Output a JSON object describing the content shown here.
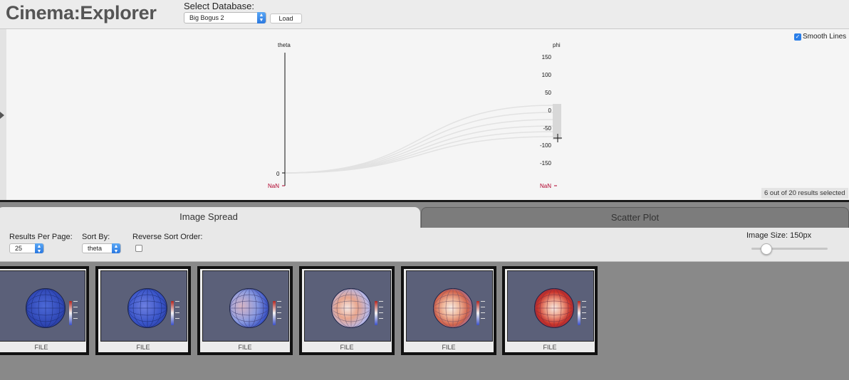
{
  "header": {
    "title": "Cinema:Explorer",
    "db_label": "Select Database:",
    "db_selected": "Big Bogus 2",
    "load_label": "Load"
  },
  "plot": {
    "axes": [
      {
        "name": "theta",
        "ticks": [
          "0"
        ],
        "nan_label": "NaN"
      },
      {
        "name": "phi",
        "ticks": [
          "150",
          "100",
          "50",
          "0",
          "-50",
          "-100",
          "-150"
        ],
        "nan_label": "NaN"
      }
    ],
    "smooth_lines_label": "Smooth Lines",
    "smooth_lines_checked": true,
    "selected_count": "6 out of 20 results selected"
  },
  "tabs": [
    {
      "label": "Image Spread",
      "active": true
    },
    {
      "label": "Scatter Plot",
      "active": false
    }
  ],
  "controls": {
    "results_per_page_label": "Results Per Page:",
    "results_per_page_value": "25",
    "sort_by_label": "Sort By:",
    "sort_by_value": "theta",
    "reverse_sort_label": "Reverse Sort Order:",
    "reverse_sort_checked": false,
    "image_size_label": "Image Size: 150px"
  },
  "results": [
    {
      "label": "FILE"
    },
    {
      "label": "FILE"
    },
    {
      "label": "FILE"
    },
    {
      "label": "FILE"
    },
    {
      "label": "FILE"
    },
    {
      "label": "FILE"
    }
  ],
  "colors": {
    "accent": "#2a7ee8",
    "nan": "#b0002a",
    "panel": "#f5f5f5",
    "image_bg": "#5b6079"
  }
}
